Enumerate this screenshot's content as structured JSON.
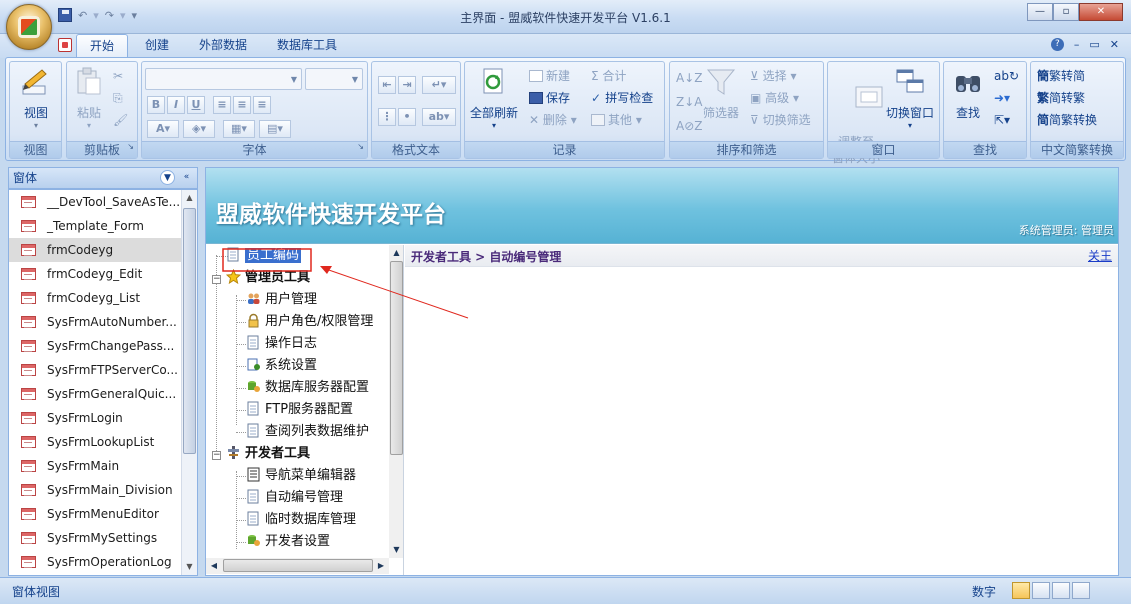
{
  "window": {
    "title": "主界面 - 盟威软件快速开发平台 V1.6.1"
  },
  "ribbon_tabs": [
    "开始",
    "创建",
    "外部数据",
    "数据库工具"
  ],
  "groups": {
    "view": {
      "label": "视图",
      "button": "视图"
    },
    "clipboard": {
      "label": "剪贴板",
      "paste": "粘贴"
    },
    "font": {
      "label": "字体"
    },
    "rich_text": {
      "label": "格式文本"
    },
    "records": {
      "label": "记录",
      "refresh_all": "全部刷新",
      "new": "新建",
      "save": "保存",
      "delete": "删除",
      "totals": "合计",
      "spelling": "拼写检查",
      "more": "其他"
    },
    "sort_filter": {
      "label": "排序和筛选",
      "filter": "筛选器",
      "selection": "选择",
      "advanced": "高级",
      "toggle_filter": "切换筛选"
    },
    "window": {
      "label": "窗口",
      "size_to_fit": "调整至\n窗体大小",
      "switch_windows": "切换窗口"
    },
    "find": {
      "label": "查找",
      "find": "查找"
    },
    "chinese_conv": {
      "label": "中文简繁转换",
      "trad_to_simp": "繁转简",
      "simp_to_trad": "简转繁",
      "conversion": "简繁转换"
    }
  },
  "nav_pane": {
    "header": "窗体",
    "items": [
      "__DevTool_SaveAsTe...",
      "_Template_Form",
      "frmCodeyg",
      "frmCodeyg_Edit",
      "frmCodeyg_List",
      "SysFrmAutoNumber...",
      "SysFrmChangePass...",
      "SysFrmFTPServerCo...",
      "SysFrmGeneralQuic...",
      "SysFrmLogin",
      "SysFrmLookupList",
      "SysFrmMain",
      "SysFrmMain_Division",
      "SysFrmMenuEditor",
      "SysFrmMySettings",
      "SysFrmOperationLog"
    ],
    "selected": "frmCodeyg"
  },
  "banner": {
    "title": "盟威软件快速开发平台",
    "user": "系统管理员: 管理员"
  },
  "tree": {
    "selected_item": "员工编码",
    "admin_group": "管理员工具",
    "admin_items": [
      "用户管理",
      "用户角色/权限管理",
      "操作日志",
      "系统设置",
      "数据库服务器配置",
      "FTP服务器配置",
      "查阅列表数据维护"
    ],
    "dev_group": "开发者工具",
    "dev_items": [
      "导航菜单编辑器",
      "自动编号管理",
      "临时数据库管理",
      "开发者设置"
    ]
  },
  "content": {
    "breadcrumb": "开发者工具 > 自动编号管理",
    "close_link": "关王"
  },
  "status": {
    "left": "窗体视图",
    "mode": "数字"
  },
  "colors": {
    "annotation_red": "#e0281e",
    "banner": "#6fc2df",
    "selection": "#3a6fce"
  }
}
